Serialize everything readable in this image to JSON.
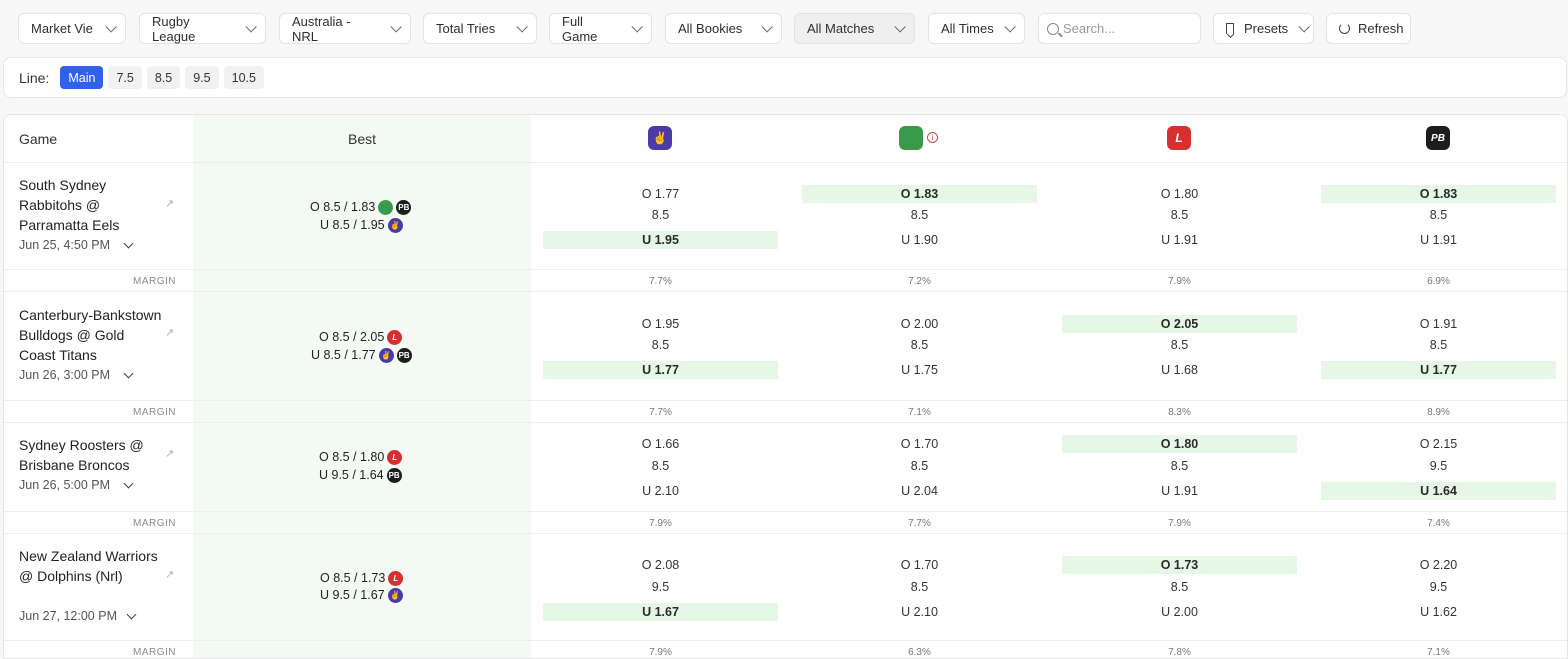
{
  "filters": {
    "market_view": "Market Vie",
    "sport": "Rugby League",
    "league": "Australia - NRL",
    "market": "Total Tries",
    "period": "Full Game",
    "bookies": "All Bookies",
    "matches": "All Matches",
    "times": "All Times",
    "search_placeholder": "Search...",
    "presets": "Presets",
    "refresh": "Refresh"
  },
  "line": {
    "label": "Line:",
    "options": [
      "Main",
      "7.5",
      "8.5",
      "9.5",
      "10.5"
    ],
    "selected": "Main"
  },
  "table": {
    "game_header": "Game",
    "best_header": "Best",
    "margin_label": "MARGIN",
    "bookmakers": [
      {
        "icon": "purple-bookmaker-icon",
        "color": "#4b3aa8"
      },
      {
        "icon": "green-bookmaker-icon",
        "color": "#3a9a4a"
      },
      {
        "icon": "red-bookmaker-icon",
        "color": "#d6302f"
      },
      {
        "icon": "black-bookmaker-icon",
        "color": "#1d1d1d"
      }
    ],
    "games": [
      {
        "name": "South Sydney Rabbitohs @ Parramatta Eels",
        "date": "Jun 25, 4:50 PM",
        "best_over": "O 8.5 / 1.83",
        "best_under": "U 8.5 / 1.95",
        "odds": [
          {
            "over": "O 1.77",
            "line": "8.5",
            "under": "U 1.95",
            "margin": "7.7%"
          },
          {
            "over": "O 1.83",
            "line": "8.5",
            "under": "U 1.90",
            "margin": "7.2%"
          },
          {
            "over": "O 1.80",
            "line": "8.5",
            "under": "U 1.91",
            "margin": "7.9%"
          },
          {
            "over": "O 1.83",
            "line": "8.5",
            "under": "U 1.91",
            "margin": "6.9%"
          }
        ]
      },
      {
        "name": "Canterbury-Bankstown Bulldogs @ Gold Coast Titans",
        "date": "Jun 26, 3:00 PM",
        "best_over": "O 8.5 / 2.05",
        "best_under": "U 8.5 / 1.77",
        "odds": [
          {
            "over": "O 1.95",
            "line": "8.5",
            "under": "U 1.77",
            "margin": "7.7%"
          },
          {
            "over": "O 2.00",
            "line": "8.5",
            "under": "U 1.75",
            "margin": "7.1%"
          },
          {
            "over": "O 2.05",
            "line": "8.5",
            "under": "U 1.68",
            "margin": "8.3%"
          },
          {
            "over": "O 1.91",
            "line": "8.5",
            "under": "U 1.77",
            "margin": "8.9%"
          }
        ]
      },
      {
        "name": "Sydney Roosters @ Brisbane Broncos",
        "date": "Jun 26, 5:00 PM",
        "best_over": "O 8.5 / 1.80",
        "best_under": "U 9.5 / 1.64",
        "odds": [
          {
            "over": "O 1.66",
            "line": "8.5",
            "under": "U 2.10",
            "margin": "7.9%"
          },
          {
            "over": "O 1.70",
            "line": "8.5",
            "under": "U 2.04",
            "margin": "7.7%"
          },
          {
            "over": "O 1.80",
            "line": "8.5",
            "under": "U 1.91",
            "margin": "7.9%"
          },
          {
            "over": "O 2.15",
            "line": "9.5",
            "under": "U 1.64",
            "margin": "7.4%"
          }
        ]
      },
      {
        "name": "New Zealand Warriors @ Dolphins (Nrl)",
        "date": "Jun 27, 12:00 PM",
        "best_over": "O 8.5 / 1.73",
        "best_under": "U 9.5 / 1.67",
        "odds": [
          {
            "over": "O 2.08",
            "line": "9.5",
            "under": "U 1.67",
            "margin": "7.9%"
          },
          {
            "over": "O 1.70",
            "line": "8.5",
            "under": "U 2.10",
            "margin": "6.3%"
          },
          {
            "over": "O 1.73",
            "line": "8.5",
            "under": "U 2.00",
            "margin": "7.8%"
          },
          {
            "over": "O 2.20",
            "line": "9.5",
            "under": "U 1.62",
            "margin": "7.1%"
          }
        ]
      }
    ]
  }
}
